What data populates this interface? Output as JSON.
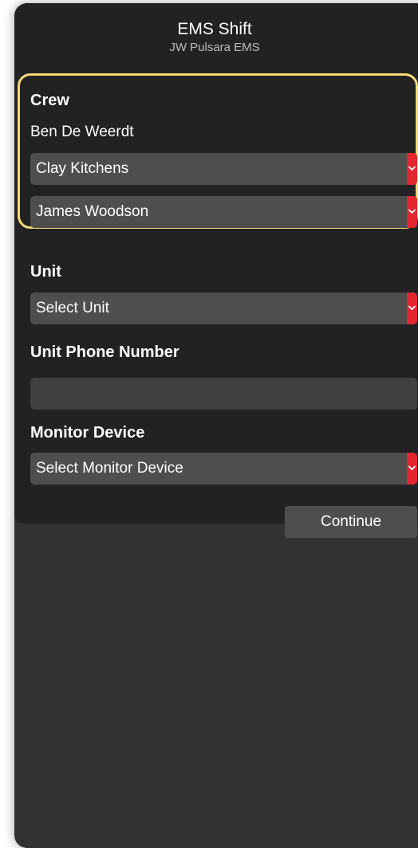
{
  "header": {
    "title": "EMS Shift",
    "subtitle": "JW Pulsara EMS"
  },
  "crew": {
    "label": "Crew",
    "lead_member": "Ben De Weerdt",
    "members": [
      {
        "selected": "Clay Kitchens"
      },
      {
        "selected": "James Woodson"
      }
    ],
    "highlight_color": "#f4d977"
  },
  "unit": {
    "label": "Unit",
    "selected": "Select Unit"
  },
  "unit_phone": {
    "label": "Unit Phone Number",
    "value": ""
  },
  "monitor_device": {
    "label": "Monitor Device",
    "selected": "Select Monitor Device"
  },
  "actions": {
    "continue_label": "Continue"
  },
  "colors": {
    "accent_red": "#e32730",
    "background": "#323232",
    "panel": "#222222"
  },
  "icons": {
    "dropdown": "chevron-down-icon"
  }
}
